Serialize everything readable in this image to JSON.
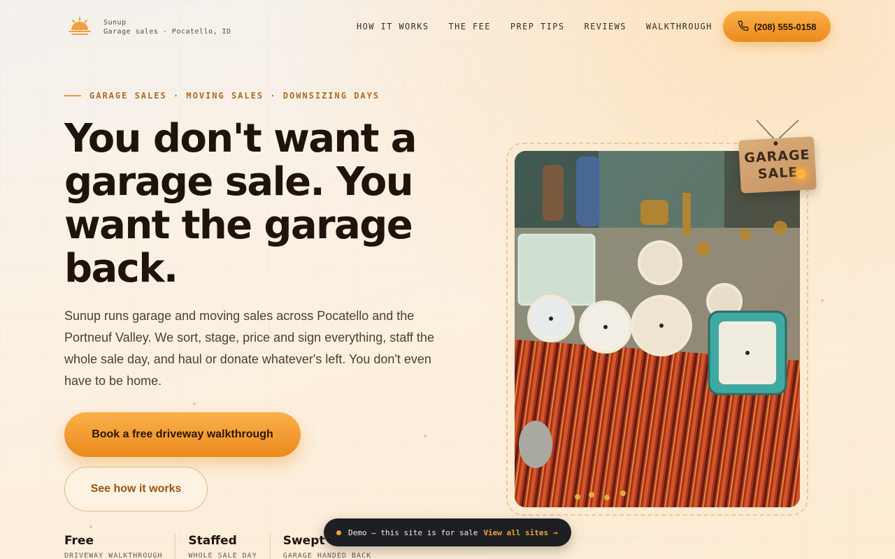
{
  "header": {
    "brand_name": "Sunup",
    "brand_tagline": "Garage sales · Pocatello, ID",
    "nav": [
      {
        "label": "HOW IT WORKS"
      },
      {
        "label": "THE FEE"
      },
      {
        "label": "PREP TIPS"
      },
      {
        "label": "REVIEWS"
      },
      {
        "label": "WALKTHROUGH"
      }
    ],
    "phone": "(208) 555-0158"
  },
  "hero": {
    "eyebrow": "GARAGE SALES · MOVING SALES · DOWNSIZING DAYS",
    "headline": "You don't want a garage sale. You want the garage back.",
    "lede": "Sunup runs garage and moving sales across Pocatello and the Portneuf Valley. We sort, stage, price and sign everything, staff the whole sale day, and haul or donate whatever's left. You don't even have to be home.",
    "cta_primary": "Book a free driveway walkthrough",
    "cta_secondary": "See how it works",
    "stats": [
      {
        "title": "Free",
        "caption": "DRIVEWAY WALKTHROUGH"
      },
      {
        "title": "Staffed",
        "caption": "WHOLE SALE DAY"
      },
      {
        "title": "Swept",
        "caption": "GARAGE HANDED BACK"
      }
    ]
  },
  "photo": {
    "tag_line1": "GARAGE",
    "tag_line2": "SALE"
  },
  "demo_bar": {
    "text": "Demo — this site is for sale",
    "link": "View all sites →"
  },
  "colors": {
    "accent": "#f3a040",
    "accent_dark": "#b06a22",
    "ink": "#1e140c"
  }
}
